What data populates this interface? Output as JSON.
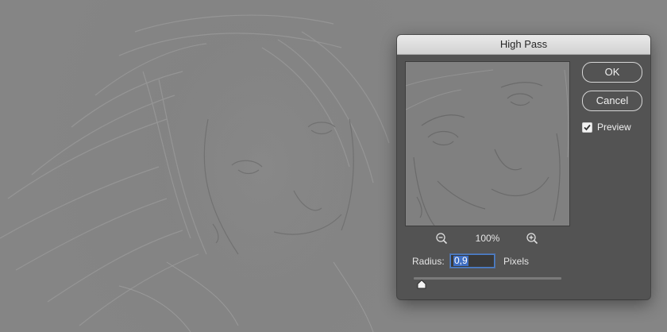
{
  "dialog": {
    "title": "High Pass",
    "ok_label": "OK",
    "cancel_label": "Cancel",
    "preview_label": "Preview",
    "preview_checked": true,
    "zoom_level": "100%",
    "radius_label": "Radius:",
    "radius_value": "0,9",
    "units_label": "Pixels",
    "slider_position": 0.02
  },
  "icons": {
    "zoom_out": "zoom-out-icon",
    "zoom_in": "zoom-in-icon",
    "checkmark": "checkmark-icon"
  },
  "colors": {
    "canvas": "#858585",
    "dialog": "#535353",
    "selection": "#3f6fc4"
  }
}
